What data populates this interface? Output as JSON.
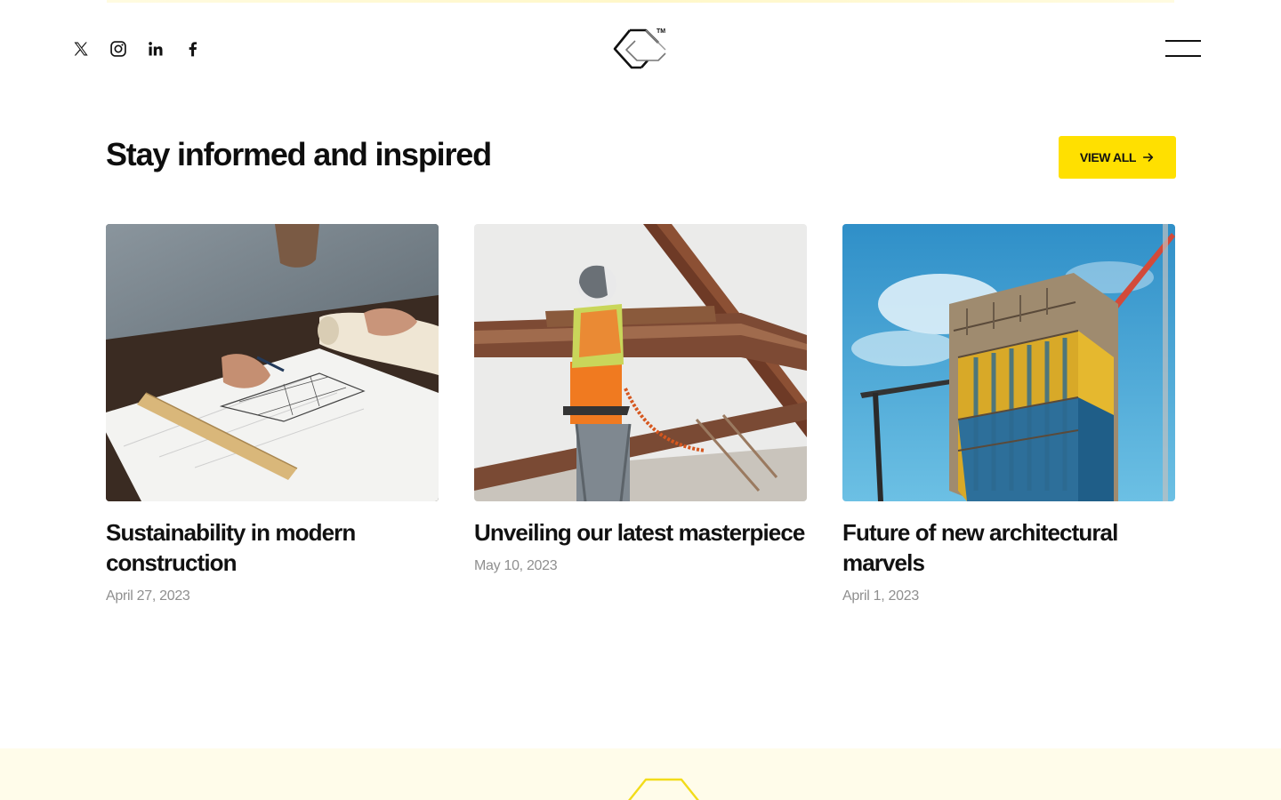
{
  "header": {
    "social": [
      {
        "name": "x-icon",
        "label": "X"
      },
      {
        "name": "instagram-icon",
        "label": "Instagram"
      },
      {
        "name": "linkedin-icon",
        "label": "LinkedIn"
      },
      {
        "name": "facebook-icon",
        "label": "Facebook"
      }
    ],
    "logo_icon": "brand-logo-icon",
    "menu_icon": "hamburger-menu-icon"
  },
  "section": {
    "title": "Stay informed and inspired",
    "view_all_label": "VIEW ALL",
    "view_all_icon": "arrow-right-icon"
  },
  "posts": [
    {
      "title": "Sustainability in modern construction",
      "date": "April 27, 2023",
      "image": "architect-drawing-blueprint-photo"
    },
    {
      "title": "Unveiling our latest masterpiece",
      "date": "May 10, 2023",
      "image": "worker-steel-beams-photo"
    },
    {
      "title": "Future of new architectural marvels",
      "date": "April 1, 2023",
      "image": "building-under-construction-photo"
    }
  ],
  "colors": {
    "accent": "#ffe000",
    "footer_background": "#fffcea",
    "date_text": "#8f8f8f"
  }
}
